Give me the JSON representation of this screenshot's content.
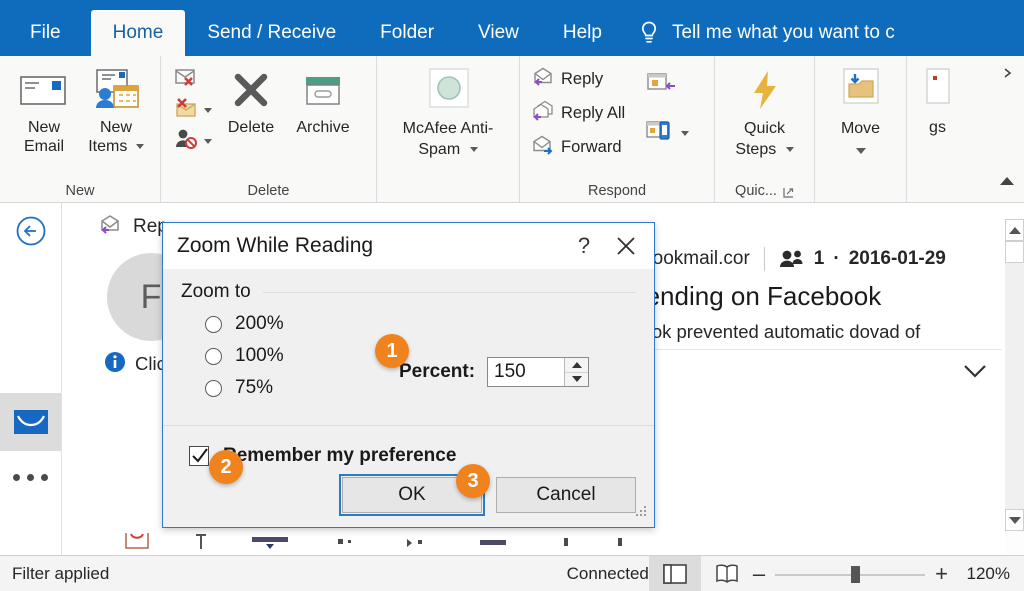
{
  "ribbon": {
    "tabs": [
      {
        "label": "File",
        "active": false
      },
      {
        "label": "Home",
        "active": true
      },
      {
        "label": "Send / Receive",
        "active": false
      },
      {
        "label": "Folder",
        "active": false
      },
      {
        "label": "View",
        "active": false
      },
      {
        "label": "Help",
        "active": false
      }
    ],
    "tell_me": "Tell me what you want to c",
    "groups": [
      {
        "name": "New",
        "label": "New",
        "buttons": [
          {
            "label_line1": "New",
            "label_line2": "Email",
            "icon": "new-email-icon"
          },
          {
            "label_line1": "New",
            "label_line2": "Items",
            "icon": "new-items-icon",
            "has_caret": true
          }
        ]
      },
      {
        "name": "Delete",
        "label": "Delete",
        "small_buttons": [
          {
            "label": "",
            "icon": "ignore-icon"
          },
          {
            "label": "",
            "icon": "junk-icon",
            "has_caret": true
          },
          {
            "label": "",
            "icon": "block-sender-icon",
            "has_caret": true
          }
        ],
        "buttons": [
          {
            "label_line1": "Delete",
            "label_line2": "",
            "icon": "delete-x-icon"
          },
          {
            "label_line1": "Archive",
            "label_line2": "",
            "icon": "archive-icon"
          }
        ]
      },
      {
        "name": "McAfee",
        "label": "",
        "buttons": [
          {
            "label_line1": "McAfee Anti-",
            "label_line2": "Spam",
            "icon": "mcafee-icon",
            "has_caret": true
          }
        ]
      },
      {
        "name": "Respond",
        "label": "Respond",
        "small_buttons": [
          {
            "label": "Reply",
            "icon": "reply-icon"
          },
          {
            "label": "Reply All",
            "icon": "reply-all-icon"
          },
          {
            "label": "Forward",
            "icon": "forward-icon"
          }
        ],
        "extra_buttons": [
          {
            "label": "",
            "icon": "meeting-icon"
          },
          {
            "label": "",
            "icon": "more-respond-icon",
            "has_caret": true
          }
        ]
      },
      {
        "name": "QuickSteps",
        "label": "Quic...",
        "buttons": [
          {
            "label_line1": "Quick",
            "label_line2": "Steps",
            "icon": "quick-steps-icon",
            "has_caret": true
          }
        ]
      },
      {
        "name": "Move",
        "label": "",
        "buttons": [
          {
            "label_line1": "Move",
            "label_line2": "",
            "icon": "move-folder-icon",
            "has_caret": true
          }
        ]
      },
      {
        "name": "Tags",
        "label": "",
        "buttons": [
          {
            "label_line1": "gs",
            "label_line2": "",
            "icon": "tags-icon"
          }
        ]
      }
    ]
  },
  "nav_rail": {
    "back_icon": "back-arrow-icon",
    "items": [
      {
        "name": "mail",
        "icon": "mail-icon",
        "active": true
      },
      {
        "name": "more",
        "icon": "ellipsis-icon",
        "active": false
      }
    ]
  },
  "reading_pane": {
    "toolbar": {
      "reply_label": "Rep",
      "reply_icon": "reply-icon"
    },
    "avatar_initial": "F",
    "info_icon": "info-icon",
    "info_text": "Click som",
    "recipients_icon": "people-icon",
    "recipients_count": "1",
    "date": "2016-01-29",
    "sender_domain": "cebookmail.cor",
    "subject": "Trending on Facebook",
    "warning": "utlook prevented automatic dovad of",
    "expand_icon": "chevron-down-icon"
  },
  "dialog": {
    "title": "Zoom While Reading",
    "help_icon": "help-question-icon",
    "close_icon": "close-icon",
    "section_label": "Zoom to",
    "radios": [
      {
        "label": "200%",
        "checked": false
      },
      {
        "label": "100%",
        "checked": false
      },
      {
        "label": "75%",
        "checked": false
      }
    ],
    "percent_label": "Percent:",
    "percent_value": "150",
    "spinner_up_icon": "spinner-up-icon",
    "spinner_down_icon": "spinner-down-icon",
    "checkbox_label": "Remember my preference",
    "checkbox_checked": true,
    "ok_label": "OK",
    "cancel_label": "Cancel"
  },
  "callouts": [
    {
      "number": "1"
    },
    {
      "number": "2"
    },
    {
      "number": "3"
    }
  ],
  "status_bar": {
    "left_text": "Filter applied",
    "connection_text": "Connected",
    "reading_pane_icon": "reading-pane-icon",
    "read_mode_icon": "reading-mode-icon",
    "zoom_out_label": "–",
    "zoom_in_label": "+",
    "zoom_level": "120%"
  },
  "colors": {
    "ribbon_blue": "#0f6cbd",
    "accent_orange": "#f0831e",
    "dialog_border_blue": "#2a7cc7",
    "mail_icon_blue": "#1668c1"
  }
}
